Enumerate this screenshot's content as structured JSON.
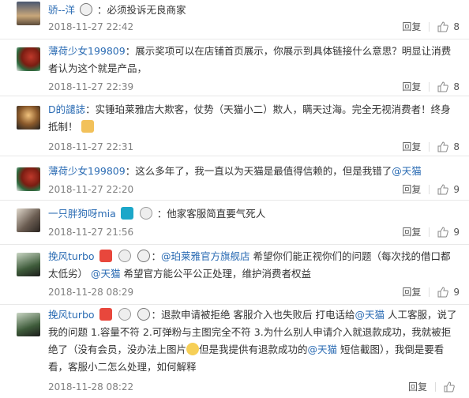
{
  "comments": [
    {
      "user": "骄--洋",
      "text": "：必须投诉无良商家",
      "time": "2018-11-27 22:42",
      "likes": "8",
      "reply": "回复"
    },
    {
      "user": "薄荷少女199809",
      "text": "：展示奖项可以在店铺首页展示，你展示到具体链接什么意思？明显让消费者认为这个就是产品，",
      "time": "2018-11-27 22:39",
      "likes": "8",
      "reply": "回复"
    },
    {
      "user": "D的譴誌",
      "text": "：实锤珀莱雅店大欺客，仗势（天猫小二）欺人，瞒天过海。完全无视消费者！终身抵制！",
      "time": "2018-11-27 22:31",
      "likes": "8",
      "reply": "回复"
    },
    {
      "user": "薄荷少女199809",
      "text": "：这么多年了，我一直以为天猫是最值得信赖的，但是我错了",
      "mention": "@天猫",
      "time": "2018-11-27 22:20",
      "likes": "9",
      "reply": "回复"
    },
    {
      "user": "一只胖狗呀mia",
      "text": "：他家客服简直要气死人",
      "time": "2018-11-27 21:56",
      "likes": "9",
      "reply": "回复"
    },
    {
      "user": "挽风turbo",
      "pre": "：",
      "mention1": "@珀莱雅官方旗舰店",
      "mid": " 希望你们能正视你们的问题（每次找的借口都太低劣）",
      "mention2": "@天猫",
      "post": " 希望官方能公平公正处理，维护消费者权益",
      "time": "2018-11-28 08:29",
      "likes": "9",
      "reply": "回复"
    },
    {
      "user": "挽风turbo",
      "pre": "：退款申请被拒绝 客服介入也失败后 打电话给",
      "mention1": "@天猫",
      "mid": " 人工客服，说了我的问题 1.容量不符 2.可弹粉与主图完全不符 3.为什么别人申请介入就退款成功，我就被拒绝了（没有会员，没办法上图片",
      "mid2": "但是我提供有退款成功的",
      "mention2": "@天猫",
      "post": " 短信截图），我倒是要看看，客服小二怎么处理，如何解释",
      "time": "2018-11-28 08:22",
      "likes": "",
      "reply": "回复"
    }
  ],
  "colors": {
    "link": "#2a6bb3",
    "time": "#808080"
  },
  "icons": {
    "like": "thumbs-up-icon",
    "vip": "vip-badge-icon",
    "panda": "panda-icon"
  }
}
